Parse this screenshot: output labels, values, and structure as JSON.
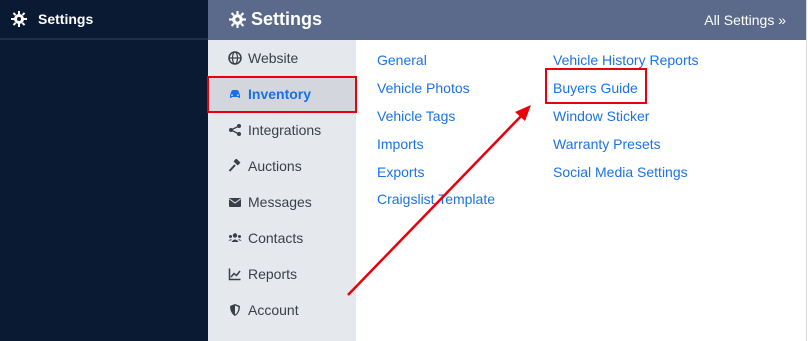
{
  "left_nav": {
    "title": "Settings",
    "icon": "gear-icon"
  },
  "header": {
    "title": "Settings",
    "icon": "gear-icon",
    "all_settings": "All Settings »"
  },
  "menu": [
    {
      "label": "Website",
      "icon": "globe-icon"
    },
    {
      "label": "Inventory",
      "icon": "car-icon",
      "active": true
    },
    {
      "label": "Integrations",
      "icon": "share-icon"
    },
    {
      "label": "Auctions",
      "icon": "gavel-icon"
    },
    {
      "label": "Messages",
      "icon": "envelope-icon"
    },
    {
      "label": "Contacts",
      "icon": "users-icon"
    },
    {
      "label": "Reports",
      "icon": "chart-icon"
    },
    {
      "label": "Account",
      "icon": "shield-icon"
    }
  ],
  "links_col1": [
    "General",
    "Vehicle Photos",
    "Vehicle Tags",
    "Imports",
    "Exports",
    "Craigslist Template"
  ],
  "links_col2": [
    "Vehicle History Reports",
    "Buyers Guide",
    "Window Sticker",
    "Warranty Presets",
    "Social Media Settings"
  ],
  "colors": {
    "accent": "#1a73e8",
    "highlight": "#e8000d",
    "header": "#5b6a8a",
    "left_nav": "#0b1a33"
  }
}
